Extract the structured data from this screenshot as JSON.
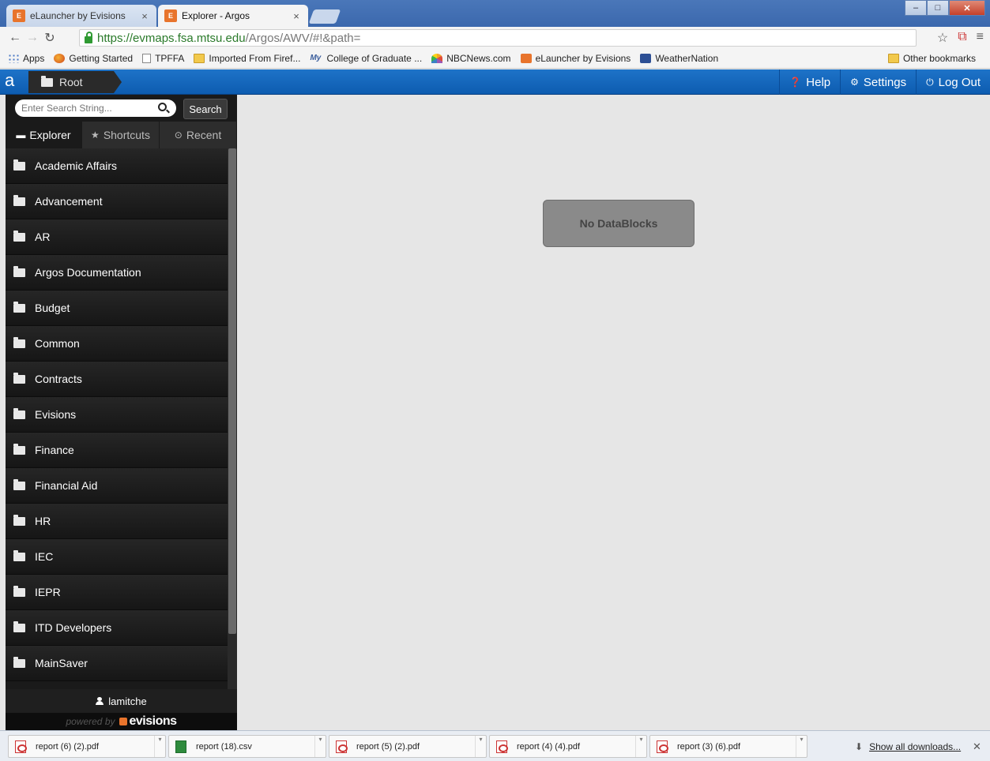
{
  "browser": {
    "tabs": [
      {
        "title": "eLauncher by Evisions",
        "active": false
      },
      {
        "title": "Explorer - Argos",
        "active": true
      }
    ],
    "url_host": "https://evmaps.fsa.mtsu.edu",
    "url_path": "/Argos/AWV/#!&path=",
    "bookmarks": [
      {
        "label": "Apps",
        "icon": "apps-grid-icon"
      },
      {
        "label": "Getting Started",
        "icon": "firefox-icon"
      },
      {
        "label": "TPFFA",
        "icon": "page-icon"
      },
      {
        "label": "Imported From Firef...",
        "icon": "folder-icon"
      },
      {
        "label": "College of Graduate ...",
        "icon": "my-icon"
      },
      {
        "label": "NBCNews.com",
        "icon": "nbc-peacock-icon"
      },
      {
        "label": "eLauncher by Evisions",
        "icon": "evisions-icon"
      },
      {
        "label": "WeatherNation",
        "icon": "weathernation-icon"
      }
    ],
    "other_bookmarks": "Other bookmarks"
  },
  "appbar": {
    "logo": "a",
    "breadcrumb": "Root",
    "nav": {
      "help": "Help",
      "settings": "Settings",
      "logout": "Log Out"
    }
  },
  "sidebar": {
    "search_placeholder": "Enter Search String...",
    "search_button": "Search",
    "tabs": [
      {
        "label": "Explorer",
        "icon": "laptop-icon",
        "active": true
      },
      {
        "label": "Shortcuts",
        "icon": "star-icon",
        "active": false
      },
      {
        "label": "Recent",
        "icon": "clock-icon",
        "active": false
      }
    ],
    "folders": [
      "Academic Affairs",
      "Advancement",
      "AR",
      "Argos Documentation",
      "Budget",
      "Common",
      "Contracts",
      "Evisions",
      "Finance",
      "Financial Aid",
      "HR",
      "IEC",
      "IEPR",
      "ITD Developers",
      "MainSaver"
    ],
    "user": "lamitche",
    "powered_by": "powered by",
    "brand": "evisions"
  },
  "main": {
    "empty_message": "No DataBlocks"
  },
  "downloads": {
    "items": [
      "report (6) (2).pdf",
      "report (18).csv",
      "report (5) (2).pdf",
      "report (4) (4).pdf",
      "report (3) (6).pdf"
    ],
    "show_all": "Show all downloads..."
  },
  "colors": {
    "appbar_blue": "#1e73c8",
    "sidebar_dark": "#1a1a1a",
    "accent_orange": "#e8742c"
  }
}
